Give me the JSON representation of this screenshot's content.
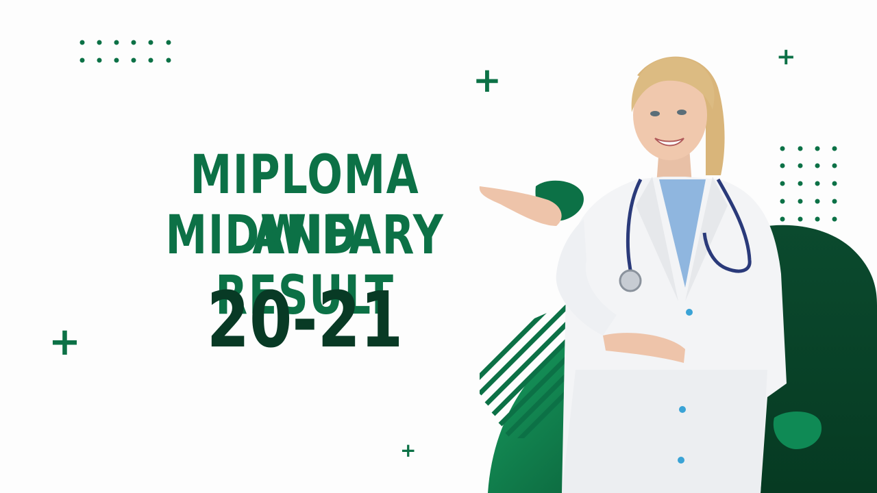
{
  "heading": {
    "line1": "MIPLOMA AND",
    "line2": "MIDWIFARY RESULT",
    "year": "20-21"
  },
  "colors": {
    "primary_green": "#0c7146",
    "dark_green": "#083a25",
    "background": "#fdfdfd"
  },
  "decorations": {
    "plus_glyph": "+",
    "icons": [
      "plus-icon",
      "dot-grid",
      "leaf-blob",
      "striped-arc"
    ]
  }
}
